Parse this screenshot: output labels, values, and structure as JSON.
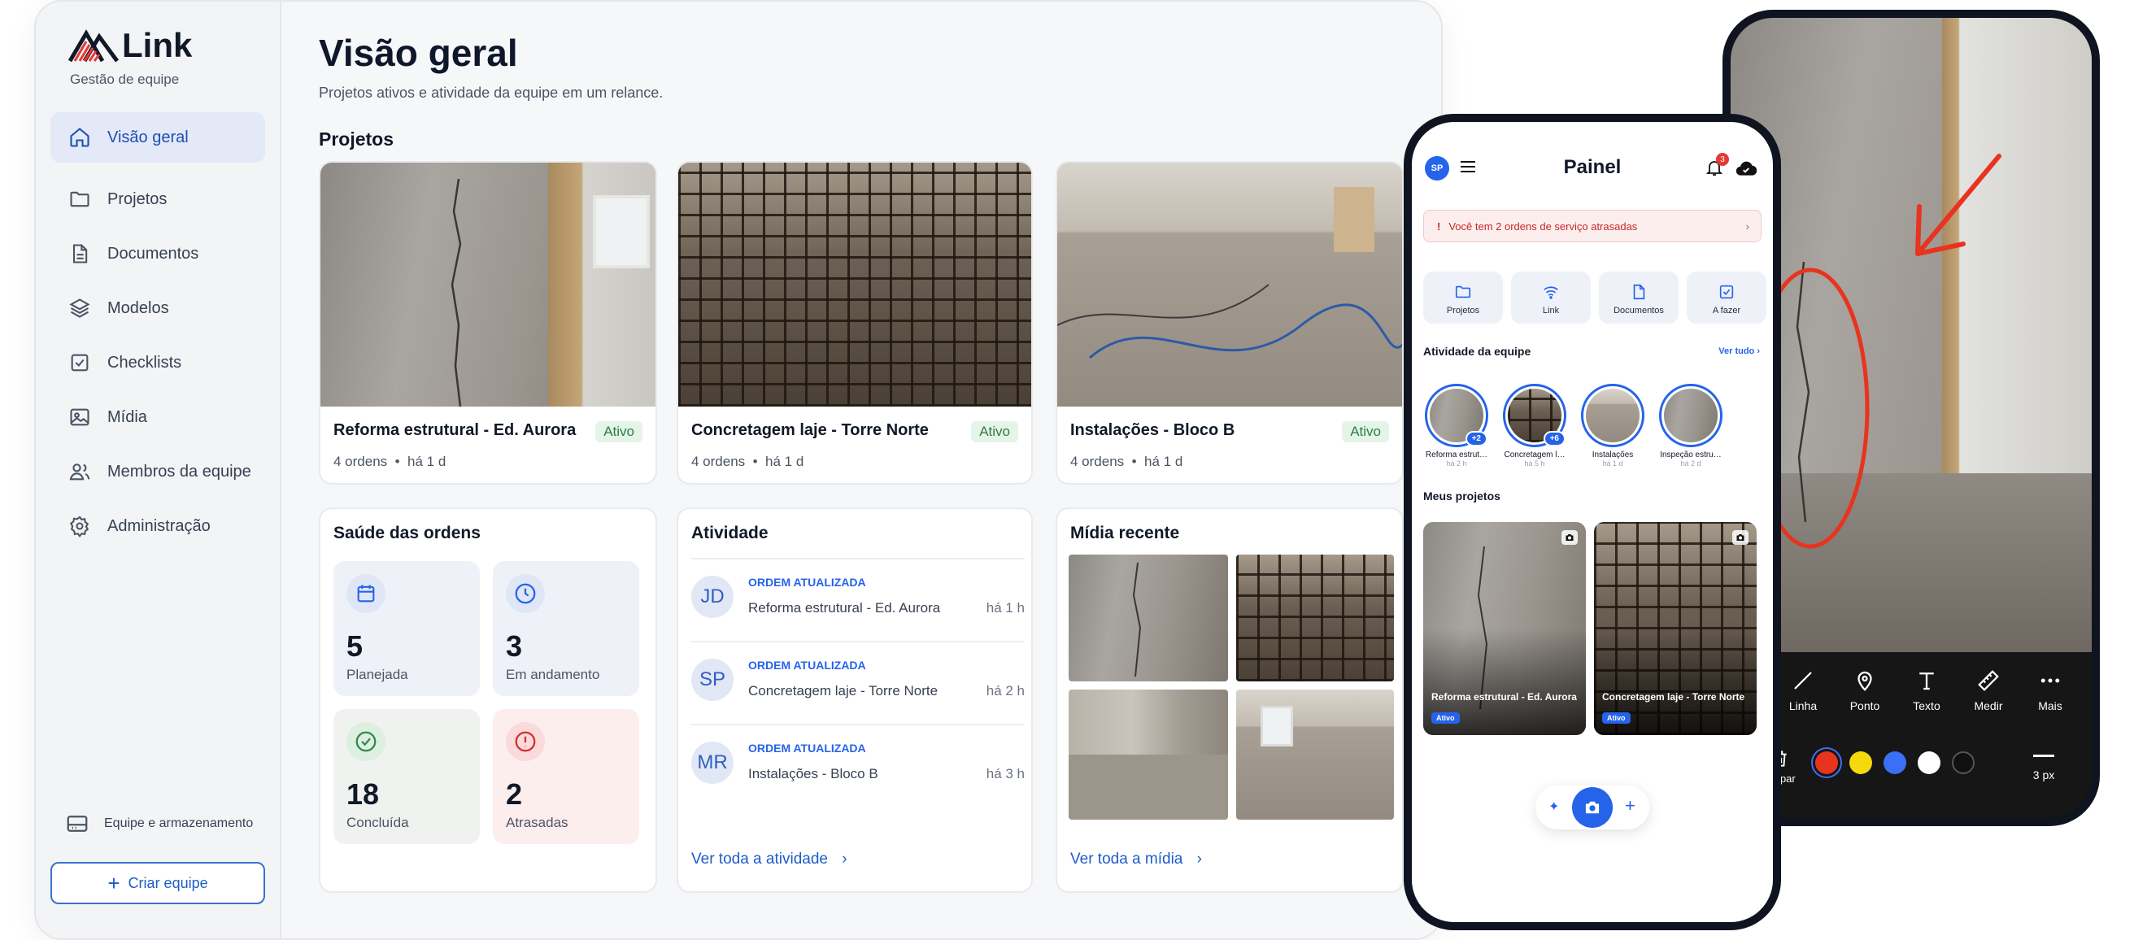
{
  "brand": {
    "name": "Link",
    "subtitle": "Gestão de equipe"
  },
  "sidebar": {
    "items": [
      {
        "label": "Visão geral",
        "icon": "home-icon",
        "active": true
      },
      {
        "label": "Projetos",
        "icon": "folder-icon"
      },
      {
        "label": "Documentos",
        "icon": "document-icon"
      },
      {
        "label": "Modelos",
        "icon": "layers-icon"
      },
      {
        "label": "Checklists",
        "icon": "checkbox-icon"
      },
      {
        "label": "Mídia",
        "icon": "image-icon"
      },
      {
        "label": "Membros da equipe",
        "icon": "users-icon"
      },
      {
        "label": "Administração",
        "icon": "gear-icon"
      }
    ],
    "storage_label": "Equipe e armazenamento",
    "create_team_label": "Criar equipe"
  },
  "header": {
    "title": "Visão geral",
    "subtitle": "Projetos ativos e atividade da equipe em um relance."
  },
  "projects": {
    "heading": "Projetos",
    "items": [
      {
        "name": "Reforma estrutural - Ed. Aurora",
        "status": "Ativo",
        "orders": "4 ordens",
        "updated": "há 1 d"
      },
      {
        "name": "Concretagem laje - Torre Norte",
        "status": "Ativo",
        "orders": "4 ordens",
        "updated": "há 1 d"
      },
      {
        "name": "Instalações - Bloco B",
        "status": "Ativo",
        "orders": "4 ordens",
        "updated": "há 1 d"
      }
    ]
  },
  "health": {
    "title": "Saúde das ordens",
    "stats": [
      {
        "value": "5",
        "label": "Planejada"
      },
      {
        "value": "3",
        "label": "Em andamento"
      },
      {
        "value": "18",
        "label": "Concluída"
      },
      {
        "value": "2",
        "label": "Atrasadas"
      }
    ]
  },
  "activity": {
    "title": "Atividade",
    "items": [
      {
        "initials": "JD",
        "type": "ORDEM ATUALIZADA",
        "text": "Reforma estrutural - Ed. Aurora",
        "time": "há 1 h"
      },
      {
        "initials": "SP",
        "type": "ORDEM ATUALIZADA",
        "text": "Concretagem laje - Torre Norte",
        "time": "há 2 h"
      },
      {
        "initials": "MR",
        "type": "ORDEM ATUALIZADA",
        "text": "Instalações - Bloco B",
        "time": "há 3 h"
      }
    ],
    "link": "Ver toda a atividade"
  },
  "media": {
    "title": "Mídia recente",
    "link": "Ver toda a mídia"
  },
  "mobile": {
    "avatar": "SP",
    "title": "Painel",
    "notif_count": "3",
    "alert": "Você tem 2 ordens de serviço atrasadas",
    "quick_actions": [
      "Projetos",
      "Link",
      "Documentos",
      "A fazer"
    ],
    "team_activity": "Atividade da equipe",
    "see_all": "Ver tudo ›",
    "stories": [
      {
        "title": "Reforma estrut…",
        "time": "há 2 h",
        "count": "+2"
      },
      {
        "title": "Concretagem l…",
        "time": "há 5 h",
        "count": "+6"
      },
      {
        "title": "Instalações",
        "time": "há 1 d",
        "count": ""
      },
      {
        "title": "Inspeção estru…",
        "time": "há 2 d",
        "count": ""
      }
    ],
    "my_projects": "Meus projetos",
    "project_cards": [
      {
        "title": "Reforma estrutural - Ed. Aurora",
        "status": "Ativo"
      },
      {
        "title": "Concretagem laje - Torre Norte",
        "status": "Ativo"
      }
    ]
  },
  "editor": {
    "tools": [
      "Linha",
      "Ponto",
      "Texto",
      "Medir",
      "Mais"
    ],
    "clear": "Limpar",
    "stroke": "3 px",
    "colors": [
      "#e8331f",
      "#f5d90a",
      "#3b6ff5",
      "#ffffff",
      "#111111"
    ]
  }
}
